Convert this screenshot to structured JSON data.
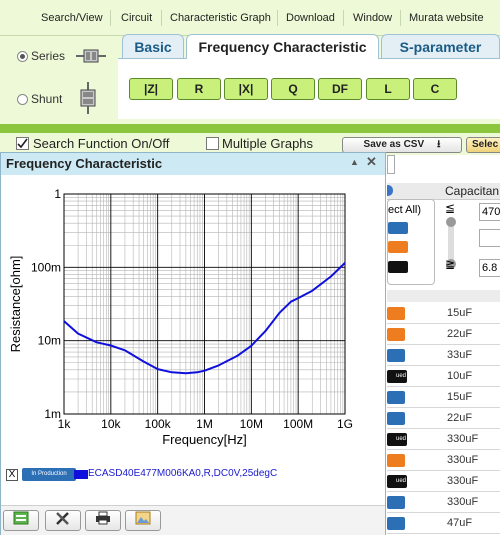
{
  "menu": {
    "items": [
      "Search/View",
      "Circuit",
      "Characteristic Graph",
      "Download",
      "Window",
      "Murata website"
    ]
  },
  "mode": {
    "series_label": "Series",
    "shunt_label": "Shunt",
    "selected": "Series"
  },
  "tabs": [
    {
      "label": "Basic",
      "active": false
    },
    {
      "label": "Frequency Characteristic",
      "active": true
    },
    {
      "label": "S-parameter",
      "active": false
    }
  ],
  "param_buttons": [
    "|Z|",
    "R",
    "|X|",
    "Q",
    "DF",
    "L",
    "C"
  ],
  "search_row": {
    "search_function_label": "Search Function On/Off",
    "search_function_checked": true,
    "multiple_graphs_label": "Multiple Graphs",
    "multiple_graphs_checked": false,
    "save_csv_label": "Save as CSV",
    "select_label": "Selec"
  },
  "right_panel": {
    "capacitance_label": "Capacitan",
    "select_all_label": "ect All)",
    "filter_values": [
      "470",
      "",
      "6.8"
    ],
    "rows": [
      {
        "status": "orange",
        "value": "15uF"
      },
      {
        "status": "orange",
        "value": "22uF"
      },
      {
        "status": "blue",
        "value": "33uF"
      },
      {
        "status": "black",
        "value": "10uF"
      },
      {
        "status": "blue",
        "value": "15uF"
      },
      {
        "status": "blue",
        "value": "22uF"
      },
      {
        "status": "black",
        "value": "330uF"
      },
      {
        "status": "orange",
        "value": "330uF"
      },
      {
        "status": "black",
        "value": "330uF"
      },
      {
        "status": "blue",
        "value": "330uF"
      },
      {
        "status": "blue",
        "value": "47uF"
      }
    ],
    "black_badge_text": "ued"
  },
  "popup": {
    "title": "Frequency Characteristic",
    "legend": {
      "close_glyph": "X",
      "status_label": "In Production",
      "series_label": "ECASD40E477M006KA0,R,DC0V,25degC",
      "color": "#1010dd"
    },
    "toolbar_icons": [
      "csv-icon",
      "tools-icon",
      "print-icon",
      "image-icon"
    ]
  },
  "chart_data": {
    "type": "line",
    "title": "",
    "xlabel": "Frequency[Hz]",
    "ylabel": "Resistance[ohm]",
    "x_scale": "log",
    "y_scale": "log",
    "xlim": [
      1000,
      1000000000
    ],
    "ylim": [
      0.001,
      1
    ],
    "x_ticks": [
      {
        "value": 1000,
        "label": "1k"
      },
      {
        "value": 10000,
        "label": "10k"
      },
      {
        "value": 100000,
        "label": "100k"
      },
      {
        "value": 1000000,
        "label": "1M"
      },
      {
        "value": 10000000,
        "label": "10M"
      },
      {
        "value": 100000000,
        "label": "100M"
      },
      {
        "value": 1000000000,
        "label": "1G"
      }
    ],
    "y_ticks": [
      {
        "value": 1,
        "label": "1"
      },
      {
        "value": 0.1,
        "label": "100m"
      },
      {
        "value": 0.01,
        "label": "10m"
      },
      {
        "value": 0.001,
        "label": "1m"
      }
    ],
    "grid": true,
    "series": [
      {
        "name": "ECASD40E477M006KA0,R,DC0V,25degC",
        "color": "#1010dd",
        "x": [
          1000,
          2000,
          5000,
          10000,
          20000,
          50000,
          100000,
          200000,
          400000,
          700000,
          1000000,
          2000000,
          5000000,
          10000000,
          20000000,
          40000000,
          70000000,
          100000000,
          200000000,
          500000000,
          1000000000
        ],
        "y": [
          0.0185,
          0.0125,
          0.0095,
          0.0086,
          0.0074,
          0.0052,
          0.0041,
          0.0037,
          0.0036,
          0.0037,
          0.0039,
          0.0046,
          0.0062,
          0.0085,
          0.0135,
          0.024,
          0.034,
          0.038,
          0.048,
          0.075,
          0.115
        ]
      }
    ]
  }
}
